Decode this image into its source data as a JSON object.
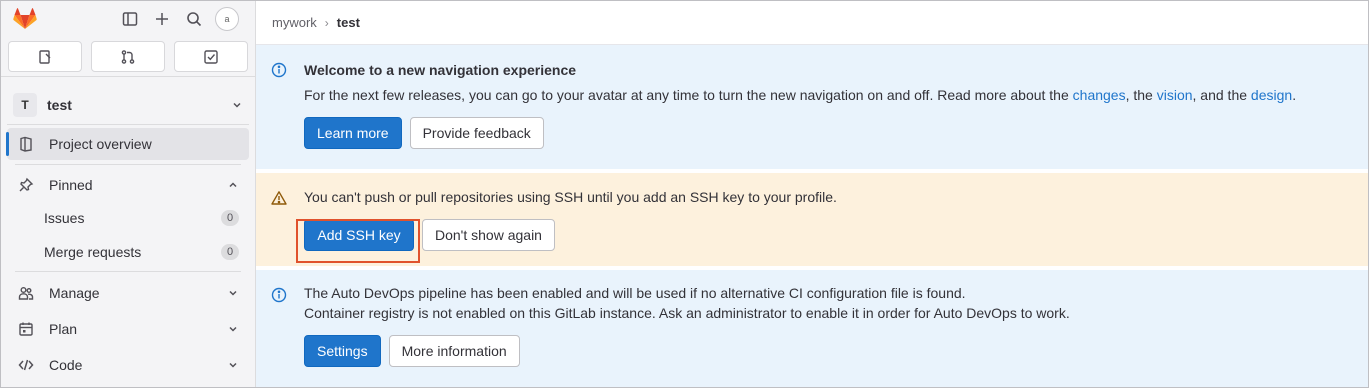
{
  "sidebar": {
    "avatar_alt": "a",
    "project": {
      "initial": "T",
      "name": "test"
    },
    "overview_label": "Project overview",
    "pinned_label": "Pinned",
    "pinned_items": [
      {
        "label": "Issues",
        "count": "0"
      },
      {
        "label": "Merge requests",
        "count": "0"
      }
    ],
    "sections": [
      {
        "label": "Manage"
      },
      {
        "label": "Plan"
      },
      {
        "label": "Code"
      }
    ]
  },
  "breadcrumb": {
    "parent": "mywork",
    "current": "test"
  },
  "alerts": {
    "welcome": {
      "title": "Welcome to a new navigation experience",
      "text_before": "For the next few releases, you can go to your avatar at any time to turn the new navigation on and off. Read more about the ",
      "link1": "changes",
      "text_mid1": ", the ",
      "link2": "vision",
      "text_mid2": ", and the ",
      "link3": "design",
      "text_end": ".",
      "primary_button": "Learn more",
      "secondary_button": "Provide feedback"
    },
    "ssh": {
      "text": "You can't push or pull repositories using SSH until you add an SSH key to your profile.",
      "primary_button": "Add SSH key",
      "secondary_button": "Don't show again"
    },
    "devops": {
      "line1": "The Auto DevOps pipeline has been enabled and will be used if no alternative CI configuration file is found.",
      "line2": "Container registry is not enabled on this GitLab instance. Ask an administrator to enable it in order for Auto DevOps to work.",
      "primary_button": "Settings",
      "secondary_button": "More information"
    }
  },
  "colors": {
    "accent": "#1f75cb",
    "info_bg": "#e9f3fc",
    "warning_bg": "#fdf1dd",
    "highlight": "#e0522c"
  }
}
